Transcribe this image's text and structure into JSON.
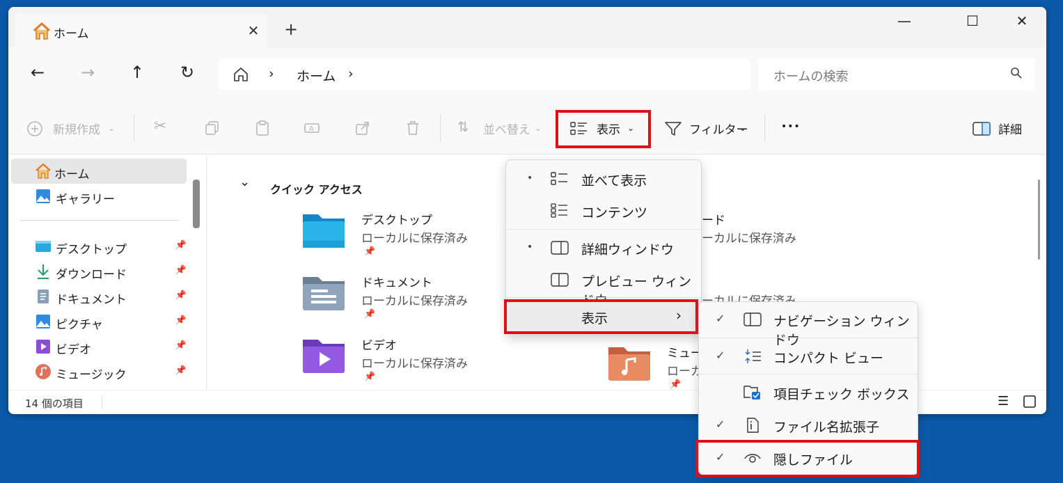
{
  "tab": {
    "title": "ホーム",
    "close": "✕",
    "new_tab": "+"
  },
  "window_controls": {
    "minimize": "—",
    "maximize": "☐",
    "close": "✕"
  },
  "nav": {
    "back": "←",
    "forward": "→",
    "up": "↑",
    "refresh": "↻"
  },
  "address": {
    "home_icon": "home-icon",
    "sep1": "›",
    "current": "ホーム",
    "sep2": "›"
  },
  "search": {
    "placeholder": "ホームの検索",
    "icon": "⚲"
  },
  "toolbar": {
    "new": "新規作成",
    "sort": "並べ替え",
    "view": "表示",
    "filter": "フィルター",
    "more": "•••",
    "details": "詳細"
  },
  "sidebar": {
    "top": [
      {
        "label": "ホーム",
        "icon": "home-icon"
      },
      {
        "label": "ギャラリー",
        "icon": "gallery-icon"
      }
    ],
    "pinned": [
      {
        "label": "デスクトップ",
        "icon": "desktop-icon"
      },
      {
        "label": "ダウンロード",
        "icon": "download-icon"
      },
      {
        "label": "ドキュメント",
        "icon": "document-icon"
      },
      {
        "label": "ピクチャ",
        "icon": "picture-icon"
      },
      {
        "label": "ビデオ",
        "icon": "video-icon"
      },
      {
        "label": "ミュージック",
        "icon": "music-icon"
      }
    ]
  },
  "quick_access": {
    "title": "クイック アクセス",
    "folders": [
      {
        "name": "デスクトップ",
        "status": "ローカルに保存済み"
      },
      {
        "name": "ドキュメント",
        "status": "ローカルに保存済み"
      },
      {
        "name": "ビデオ",
        "status": "ローカルに保存済み"
      },
      {
        "name": "ード",
        "status": "ーカルに保存済み"
      },
      {
        "name": "",
        "status": "ーカルに保存済み"
      },
      {
        "name": "ミュージッ",
        "status": "ローカル"
      }
    ]
  },
  "status": {
    "count": "14 個の項目"
  },
  "view_menu": {
    "items": [
      {
        "label": "並べて表示",
        "bullet": "•"
      },
      {
        "label": "コンテンツ"
      },
      {
        "label": "詳細ウィンドウ",
        "bullet": "•"
      },
      {
        "label": "プレビュー ウィンドウ"
      },
      {
        "label": "表示",
        "arrow": "›"
      }
    ]
  },
  "show_submenu": {
    "items": [
      {
        "label": "ナビゲーション ウィンドウ",
        "check": "✓"
      },
      {
        "label": "コンパクト ビュー",
        "check": "✓"
      },
      {
        "label": "項目チェック ボックス"
      },
      {
        "label": "ファイル名拡張子",
        "check": "✓"
      },
      {
        "label": "隠しファイル",
        "check": "✓"
      }
    ]
  },
  "colors": {
    "highlight": "#e0101b",
    "desktop_bg": "#0b5aa9"
  }
}
